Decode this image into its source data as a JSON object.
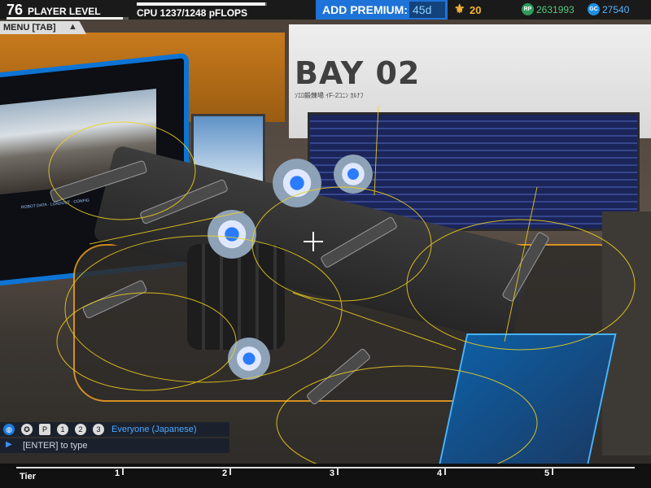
{
  "hud": {
    "player_level": "76",
    "player_level_label": "PLAYER LEVEL",
    "player_level_progress": 0.95,
    "cpu_text": "CPU 1237/1248 pFLOPS",
    "cpu_progress": 0.99,
    "premium_label": "ADD PREMIUM:",
    "premium_days": "45d",
    "tier_value": "20",
    "rp_icon": "RP",
    "rp_value": "2631993",
    "gc_icon": "GC",
    "gc_value": "27540",
    "colors": {
      "premium_blue": "#1e73d8",
      "rp_green": "#53c57a",
      "gc_blue": "#55b4ff",
      "tier_gold": "#f3b431"
    }
  },
  "menu": {
    "label": "MENU [TAB]",
    "icon": "triangle-up-icon"
  },
  "scene": {
    "bay_sign": "BAY 02",
    "bay_subtitle": "ｿｴﾛ鍛錬場 ｲF-2ｺﾆﾝ ｶﾙﾅﾌ",
    "screen_text": "ROBOT DATA · LOADOUT · CONFIG"
  },
  "chat": {
    "icons": [
      "globe-icon",
      "person-icon",
      "party-icon",
      "friends-icon",
      "clan-icon",
      "custom-icon"
    ],
    "icon_glyphs": [
      "◍",
      "✪",
      "P",
      "1",
      "2",
      "3"
    ],
    "channel": "Everyone (Japanese)",
    "input_placeholder": "[ENTER] to type"
  },
  "tier_bar": {
    "label": "Tier",
    "ticks": [
      "1",
      "2",
      "3",
      "4",
      "5"
    ]
  }
}
